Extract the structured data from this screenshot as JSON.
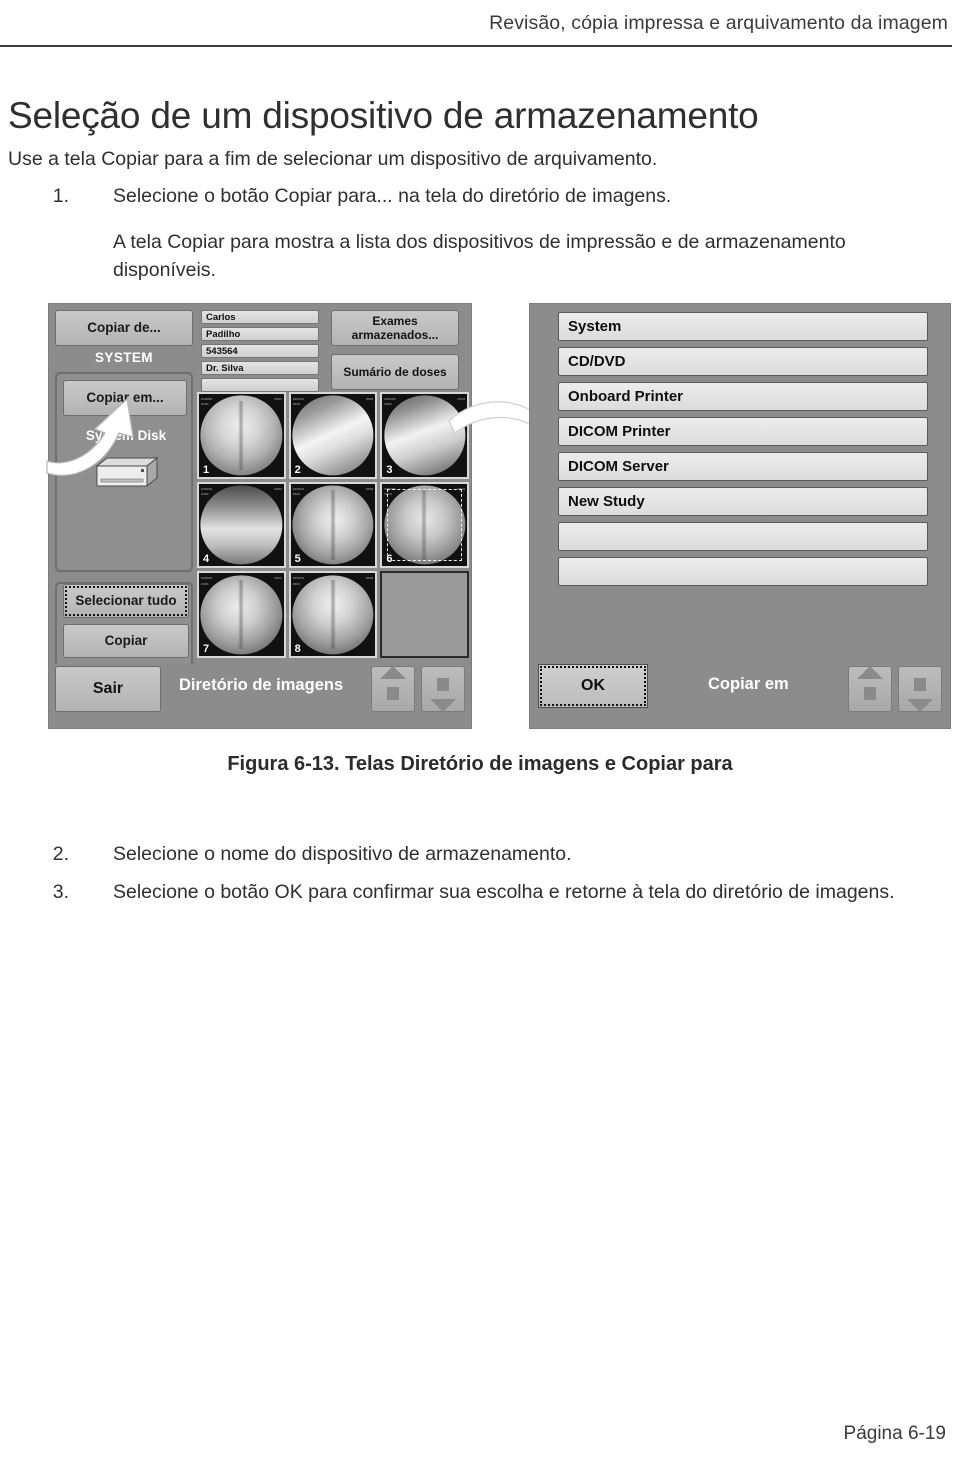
{
  "header": {
    "running_title": "Revisão, cópia impressa e arquivamento da imagem"
  },
  "title": "Seleção de um dispositivo de armazenamento",
  "lead_paragraph": "Use a tela Copiar para a fim de selecionar um dispositivo de arquivamento.",
  "steps": [
    {
      "num": "1.",
      "text": "Selecione o botão Copiar para... na tela do diretório de imagens."
    },
    {
      "num": "2.",
      "text": "Selecione o nome do dispositivo de armazenamento."
    },
    {
      "num": "3.",
      "text": "Selecione o botão OK para confirmar sua escolha e retorne à tela do diretório de imagens."
    }
  ],
  "step1_note": "A tela Copiar para mostra a lista dos dispositivos de impressão e de armazenamento disponíveis.",
  "figure": {
    "caption": "Figura 6-13. Telas Diretório de imagens e Copiar para",
    "left_screen": {
      "copy_from_button": "Copiar de...",
      "source_label": "SYSTEM",
      "copy_to_button": "Copiar em...",
      "destination_label": "System Disk",
      "select_all_button": "Selecionar tudo",
      "copy_button": "Copiar",
      "exit_button": "Sair",
      "screen_title": "Diretório de imagens",
      "patient_fields": [
        "Carlos",
        "Padilho",
        "543564",
        "Dr. Silva",
        "",
        ""
      ],
      "action_buttons": [
        "Exames armazenados...",
        "Sumário de doses"
      ],
      "thumbnails": [
        {
          "num": "1",
          "selected": false
        },
        {
          "num": "2",
          "selected": false
        },
        {
          "num": "3",
          "selected": false
        },
        {
          "num": "4",
          "selected": false
        },
        {
          "num": "5",
          "selected": false
        },
        {
          "num": "6",
          "selected": true
        },
        {
          "num": "7",
          "selected": false
        },
        {
          "num": "8",
          "selected": false
        },
        {
          "num": "",
          "selected": false
        }
      ],
      "scroll_up_icon": "arrow-up-icon",
      "scroll_down_icon": "arrow-down-icon"
    },
    "right_screen": {
      "screen_title": "Copiar em",
      "ok_button": "OK",
      "devices": [
        "System",
        "CD/DVD",
        "Onboard Printer",
        "DICOM Printer",
        "DICOM Server",
        "New Study",
        "",
        ""
      ],
      "scroll_up_icon": "arrow-up-icon",
      "scroll_down_icon": "arrow-down-icon"
    }
  },
  "footer": {
    "page_label": "Página 6-19"
  },
  "colors": {
    "panel_background": "#8c8c8c",
    "button_face": "#c9c9c9",
    "list_row": "#e4e4e4",
    "text_dark": "#2f2f2f",
    "rule": "#3d3d3d"
  }
}
